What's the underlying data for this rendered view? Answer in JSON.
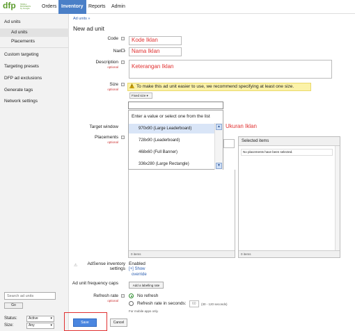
{
  "header": {
    "logo_text": "dfp",
    "logo_small": "SMALL BUSINESS",
    "logo_by": "by Google",
    "tabs": [
      {
        "label": "Orders"
      },
      {
        "label": "Inventory"
      },
      {
        "label": "Reports"
      },
      {
        "label": "Admin"
      }
    ]
  },
  "sidebar": {
    "section": "Ad units",
    "sub_items": [
      "Ad units",
      "Placements"
    ],
    "items": [
      "Custom targeting",
      "Targeting presets",
      "DFP ad exclusions",
      "Generate tags",
      "Network settings"
    ],
    "search_placeholder": "Search ad units",
    "go_label": "Go",
    "status_label": "Status:",
    "status_value": "Active",
    "size_label": "Size:",
    "size_value": "Any"
  },
  "main": {
    "breadcrumb": "Ad units »",
    "title": "New ad unit",
    "code_label": "Code",
    "code_value": "Kode Iklan",
    "name_label": "Name",
    "name_value": "Nama Iklan",
    "description_label": "Description",
    "description_optional": "optional",
    "description_value": "Keterangan Iklan",
    "size_label": "Size",
    "size_optional": "optional",
    "size_warning": "To make this ad unit easier to use, we recommend specifying at least one size.",
    "fixed_size_label": "Fixed size",
    "dropdown_hint": "Enter a value or select one from the list",
    "dropdown_options": [
      "970x90 (Large Leaderboard)",
      "728x90 (Leaderboard)",
      "468x60 (Full Banner)",
      "336x280 (Large Rectangle)"
    ],
    "annotation": "Ukuran Iklan",
    "target_window_label": "Target window",
    "placements_label": "Placements",
    "placements_optional": "optional",
    "left_pane_footer": "0 items",
    "selected_items_header": "Selected items",
    "selected_items_msg": "No placements have been selected.",
    "right_pane_footer": "0 items",
    "adsense_label": "AdSense inventory settings",
    "adsense_value": "Enabled",
    "adsense_link": "[+] Show",
    "adsense_override": "override",
    "freq_caps_label": "Ad unit frequency caps",
    "freq_caps_button": "Add a labelling rate",
    "refresh_label": "Refresh rate",
    "refresh_optional": "optional",
    "refresh_option1": "No refresh",
    "refresh_option2": "Refresh rate in seconds:",
    "refresh_value": "60",
    "refresh_hint": "(30 - 120 seconds)",
    "refresh_note": "For mobile apps only.",
    "save_label": "Save",
    "cancel_label": "Cancel"
  },
  "colors": {
    "accent": "#4a7fc7",
    "annotation": "#e03030",
    "warning_bg": "#fbf2a8"
  }
}
